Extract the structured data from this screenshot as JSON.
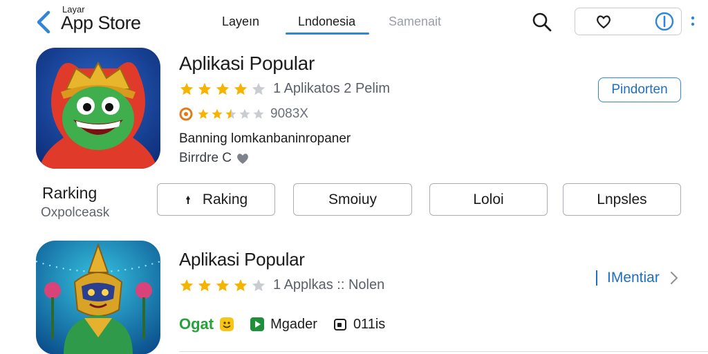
{
  "header": {
    "store_small": "Layar",
    "store_big": "App Store",
    "tabs": [
      {
        "label": "Layeın",
        "active": false
      },
      {
        "label": "Lndonesia",
        "active": true
      },
      {
        "label": "Samenait",
        "active": false
      }
    ],
    "icons": [
      "back-chevron-icon",
      "search-icon",
      "heart-icon",
      "info-icon",
      "more-vertical-icon"
    ]
  },
  "app1": {
    "title": "Aplikasi Popular",
    "stars": 4,
    "rating_text": "1 Aplikatos 2 Pelim",
    "small_stars": 2.5,
    "small_rating_text": "9083X",
    "desc": "Banning lomkanbaninropaner",
    "subdesc": "Birrdre C",
    "button": "Pindorten"
  },
  "ranking": {
    "title": "Rarking",
    "subtitle": "Oxpolceask",
    "chips": [
      "Raking",
      "Smoiuy",
      "Loloi",
      "Lnpsles"
    ]
  },
  "app2": {
    "title": "Aplikasi Popular",
    "stars": 4,
    "rating_text": "1 Applkas :: Nolen",
    "link": "IMentiar",
    "meta": {
      "gat": "Ogat",
      "label": "Mgader",
      "count": "011is"
    }
  },
  "colors": {
    "accent": "#2f86d8",
    "star": "#f4b400",
    "star_empty": "#c9ccd1",
    "inactive_tab": "#9a9ea6"
  }
}
